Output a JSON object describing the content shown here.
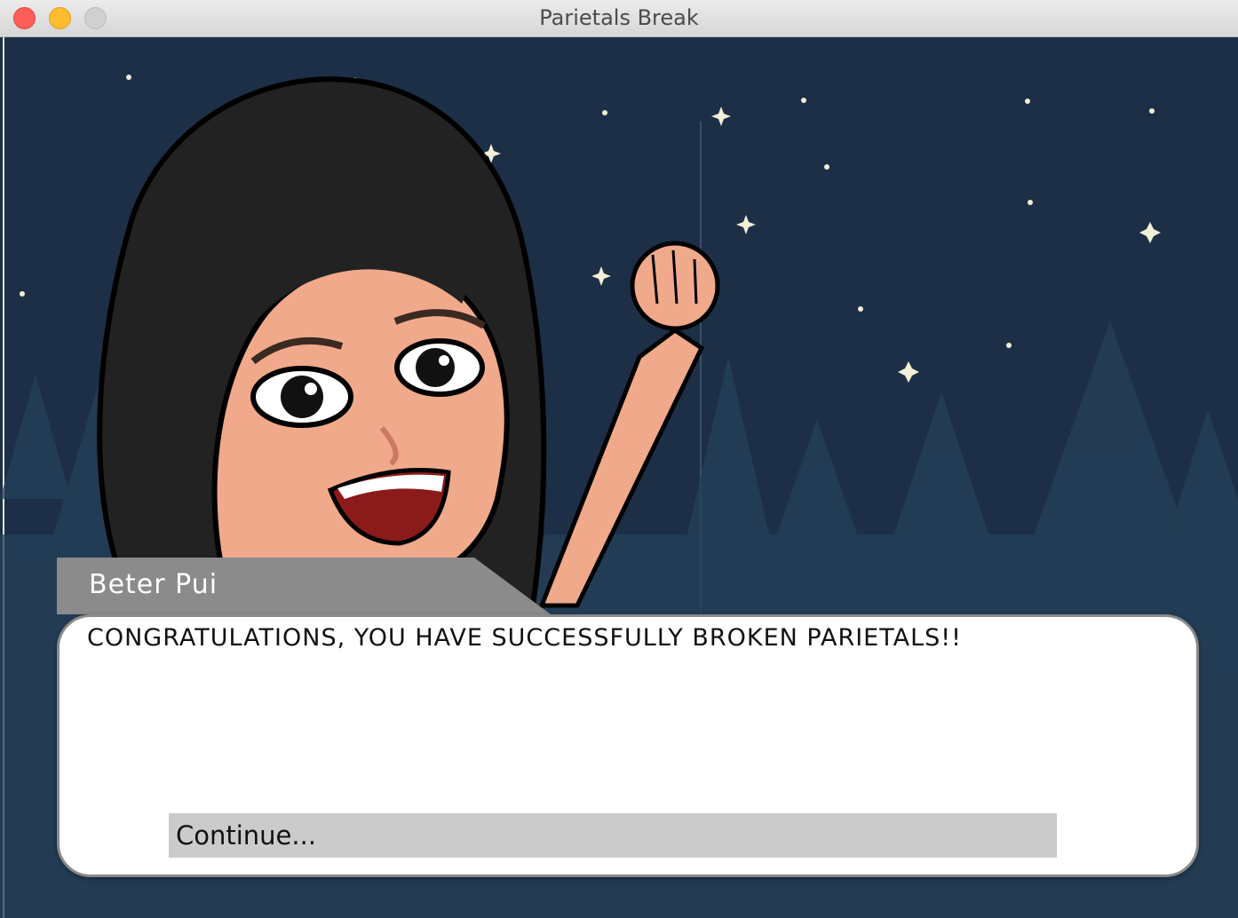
{
  "window": {
    "title": "Parietals Break"
  },
  "dialog": {
    "speaker": "Beter Pui",
    "message": "CONGRATULATIONS, YOU HAVE SUCCESSFULLY BROKEN PARIETALS!!",
    "continue_label": "Continue..."
  },
  "colors": {
    "sky": "#1c2f46",
    "name_tab": "#8b8b8b",
    "continue_button": "#cbcbcb"
  },
  "icons": [
    "close-icon",
    "minimize-icon",
    "maximize-icon"
  ]
}
